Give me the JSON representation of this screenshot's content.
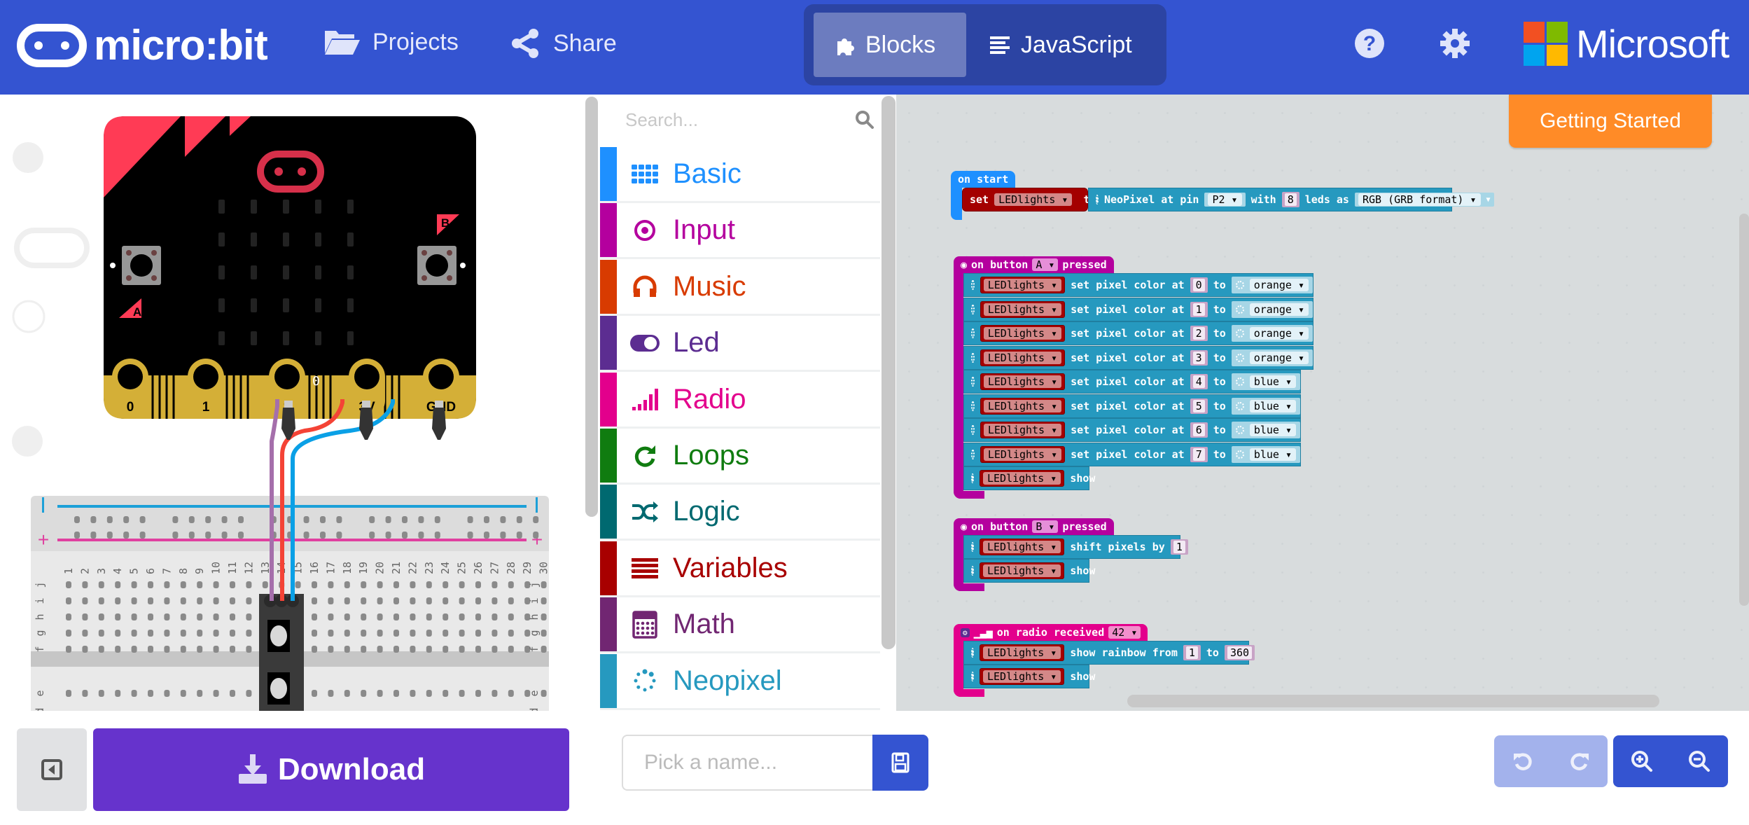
{
  "header": {
    "logo_text": "micro:bit",
    "projects_label": "Projects",
    "share_label": "Share",
    "blocks_label": "Blocks",
    "javascript_label": "JavaScript",
    "brand_label": "Microsoft",
    "brand_color": "#3454d1"
  },
  "simulator": {
    "pins": [
      "0",
      "1",
      "2",
      "3V",
      "GND"
    ],
    "button_a": "A",
    "button_b": "B",
    "pin_reading": "0",
    "breadboard_columns": [
      "1",
      "2",
      "3",
      "4",
      "5",
      "6",
      "7",
      "8",
      "9",
      "10",
      "11",
      "12",
      "13",
      "14",
      "15",
      "16",
      "17",
      "18",
      "19",
      "20",
      "21",
      "22",
      "23",
      "24",
      "25",
      "26",
      "27",
      "28",
      "29",
      "30"
    ],
    "breadboard_rows": [
      "j",
      "i",
      "h",
      "g",
      "f",
      "e",
      "d"
    ],
    "rail_minus": "−",
    "rail_plus": "+"
  },
  "toolbox": {
    "search_placeholder": "Search...",
    "categories": [
      {
        "label": "Basic",
        "color": "#1e90ff",
        "icon": "grid-icon"
      },
      {
        "label": "Input",
        "color": "#b4009e",
        "icon": "target-icon"
      },
      {
        "label": "Music",
        "color": "#d83b01",
        "icon": "headphones-icon"
      },
      {
        "label": "Led",
        "color": "#5c2d91",
        "icon": "toggle-icon"
      },
      {
        "label": "Radio",
        "color": "#e3008c",
        "icon": "signal-icon"
      },
      {
        "label": "Loops",
        "color": "#107c10",
        "icon": "refresh-icon"
      },
      {
        "label": "Logic",
        "color": "#006970",
        "icon": "shuffle-icon"
      },
      {
        "label": "Variables",
        "color": "#a80000",
        "icon": "lines-icon"
      },
      {
        "label": "Math",
        "color": "#712672",
        "icon": "calculator-icon"
      },
      {
        "label": "Neopixel",
        "color": "#2699bf",
        "icon": "neopixel-icon"
      }
    ]
  },
  "workspace": {
    "getting_started_label": "Getting Started",
    "on_start": {
      "hat": "on start",
      "set_kw": "set",
      "variable": "LEDlights",
      "to_kw": "to",
      "neopixel_text": "NeoPixel at pin",
      "pin": "P2",
      "with_kw": "with",
      "count": "8",
      "leds_as": "leds as",
      "format": "RGB (GRB format)"
    },
    "on_button_a": {
      "hat_prefix": "on button",
      "button": "A",
      "hat_suffix": "pressed",
      "variable": "LEDlights",
      "stmt_text": "set pixel color at",
      "to_kw": "to",
      "rows": [
        {
          "index": "0",
          "color": "orange"
        },
        {
          "index": "1",
          "color": "orange"
        },
        {
          "index": "2",
          "color": "orange"
        },
        {
          "index": "3",
          "color": "orange"
        },
        {
          "index": "4",
          "color": "blue"
        },
        {
          "index": "5",
          "color": "blue"
        },
        {
          "index": "6",
          "color": "blue"
        },
        {
          "index": "7",
          "color": "blue"
        }
      ],
      "show_text": "show"
    },
    "on_button_b": {
      "hat_prefix": "on button",
      "button": "B",
      "hat_suffix": "pressed",
      "variable": "LEDlights",
      "shift_text": "shift pixels by",
      "shift_value": "1",
      "show_text": "show"
    },
    "on_radio": {
      "hat": "on radio received",
      "value": "42",
      "variable": "LEDlights",
      "rainbow_text": "show rainbow from",
      "from_value": "1",
      "to_kw": "to",
      "to_value": "360",
      "show_text": "show"
    }
  },
  "bottom": {
    "download_label": "Download",
    "name_placeholder": "Pick a name...",
    "download_color": "#6633cc"
  }
}
